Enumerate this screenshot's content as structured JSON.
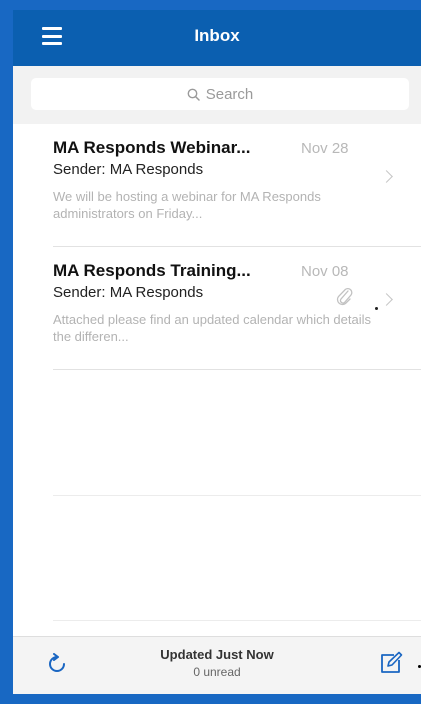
{
  "header": {
    "title": "Inbox",
    "menu_icon": "hamburger-menu-icon"
  },
  "search": {
    "placeholder": "Search",
    "icon": "search-icon"
  },
  "messages": [
    {
      "subject": "MA Responds Webinar...",
      "date": "Nov 28",
      "sender": "Sender: MA Responds",
      "preview": "We will be hosting a webinar for MA Responds administrators on Friday...",
      "has_attachment": false
    },
    {
      "subject": "MA Responds Training...",
      "date": "Nov 08",
      "sender": "Sender: MA Responds",
      "preview": "Attached please find an updated calendar which details the differen...",
      "has_attachment": true
    }
  ],
  "footer": {
    "status": "Updated Just Now",
    "unread": "0 unread",
    "refresh_icon": "refresh-icon",
    "compose_icon": "compose-icon"
  },
  "colors": {
    "header": "#0b5fb0",
    "frame": "#1868c3",
    "muted_text": "#b3b3b3"
  }
}
